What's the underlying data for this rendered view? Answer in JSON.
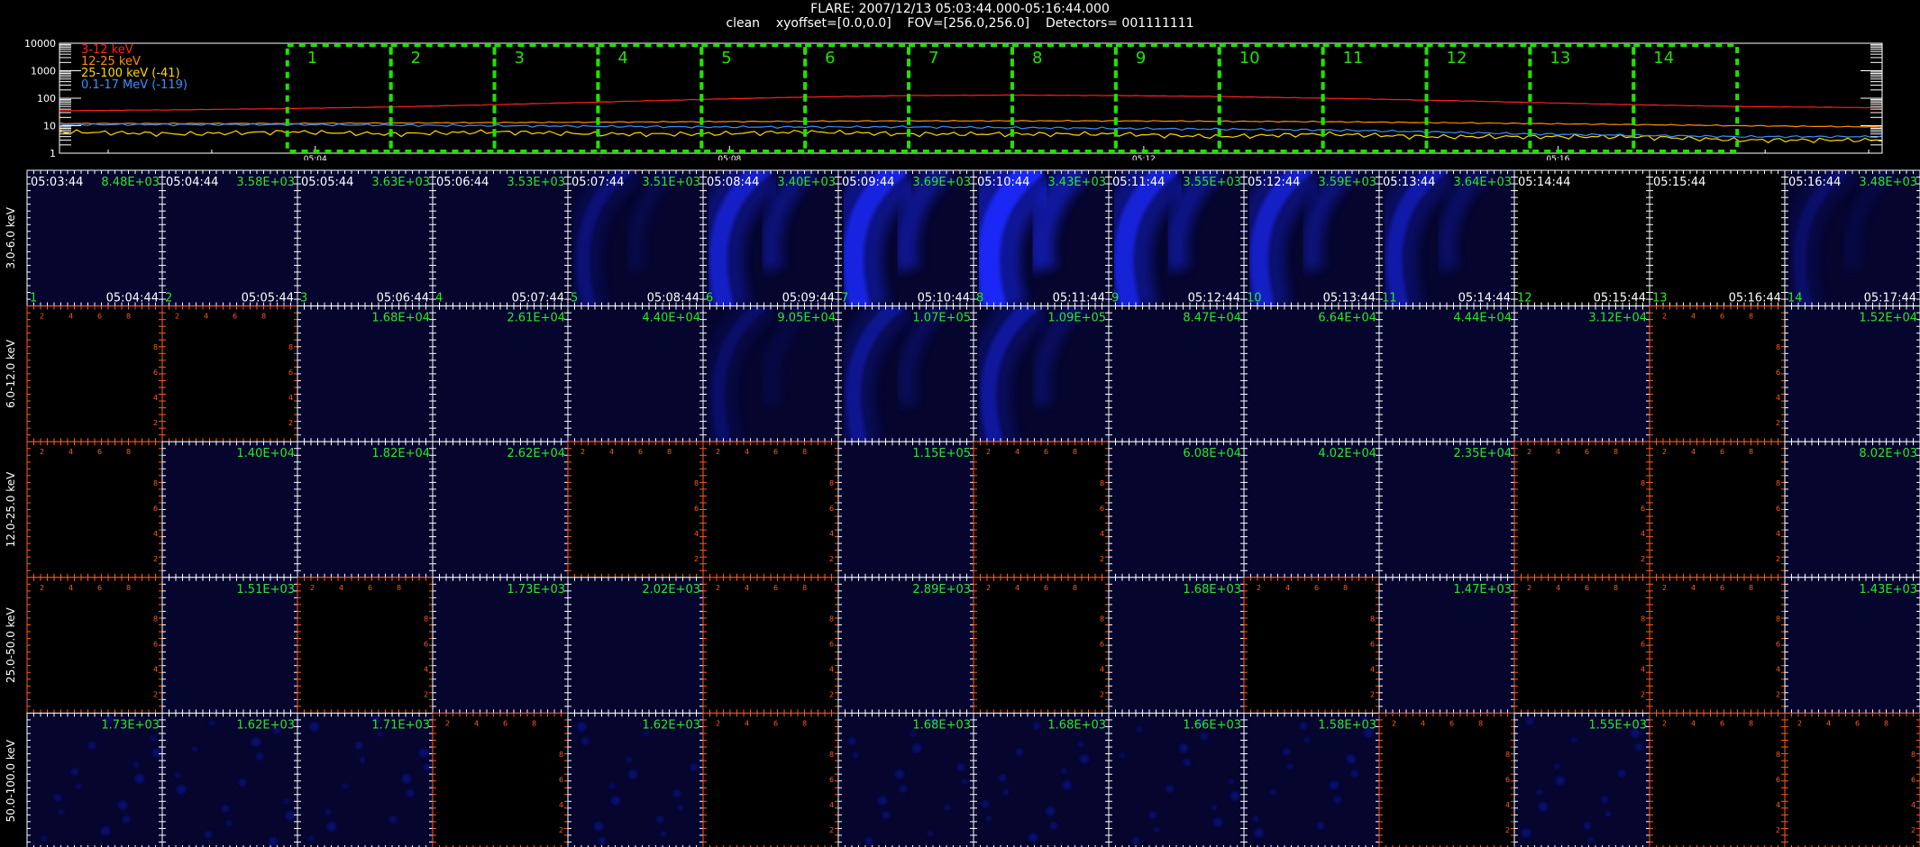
{
  "title_line1": "FLARE: 2007/12/13 05:03:44.000-05:16:44.000",
  "title_line2": "clean    xyoffset=[0.0,0.0]    FOV=[256.0,256.0]    Detectors= 001111111",
  "chart_data": [
    {
      "type": "line",
      "title": "",
      "y_scale": "log",
      "ylim": [
        1,
        10000
      ],
      "y_tick_labels": [
        "10000",
        "1000",
        "100",
        "10",
        "1"
      ],
      "x_tick_labels": [
        "05:04",
        "05:08",
        "05:12",
        "05:16"
      ],
      "x_tick_minutes": [
        0.27,
        4.27,
        8.27,
        12.27
      ],
      "x_range_minutes": [
        -2.2,
        15.4
      ],
      "legend": [
        "3-12 keV",
        "12-25 keV",
        "25-100 keV (-41)",
        "0.1-17 MeV (-119)"
      ],
      "series_colors": [
        "#ff2020",
        "#ff8c00",
        "#ffd700",
        "#3a8fff"
      ],
      "series": [
        {
          "name": "3-12 keV",
          "x": [
            -2.2,
            -1,
            0,
            1,
            2,
            3,
            4,
            5,
            6,
            7,
            8,
            9,
            10,
            11,
            12,
            13,
            14,
            15.4
          ],
          "values": [
            35,
            38,
            42,
            48,
            58,
            72,
            90,
            110,
            125,
            130,
            125,
            115,
            100,
            85,
            70,
            58,
            50,
            45
          ]
        },
        {
          "name": "12-25 keV",
          "x": [
            -2.2,
            0,
            2,
            4,
            6,
            8,
            10,
            12,
            14,
            15.4
          ],
          "values": [
            12,
            12,
            13,
            14,
            15,
            15,
            14,
            12,
            10,
            9
          ]
        },
        {
          "name": "25-100 keV (-41)",
          "x": [
            -2.2,
            -1,
            0,
            1,
            2,
            3,
            4,
            5,
            6,
            7,
            8,
            9,
            10,
            11,
            12,
            13,
            14,
            15.4
          ],
          "values": [
            6,
            5,
            6,
            5,
            6,
            5,
            5,
            6,
            5,
            5,
            5,
            4,
            5,
            4,
            4,
            4,
            3,
            3
          ]
        },
        {
          "name": "0.1-17 MeV (-119)",
          "x": [
            -2.2,
            0,
            2,
            4,
            6,
            8,
            10,
            12,
            14,
            15.4
          ],
          "values": [
            11,
            11,
            10,
            9,
            9,
            8,
            7,
            5,
            4,
            4
          ]
        }
      ],
      "intervals": [
        {
          "label": "1",
          "start": 0,
          "end": 1
        },
        {
          "label": "2",
          "start": 1,
          "end": 2
        },
        {
          "label": "3",
          "start": 2,
          "end": 3
        },
        {
          "label": "4",
          "start": 3,
          "end": 4
        },
        {
          "label": "5",
          "start": 4,
          "end": 5
        },
        {
          "label": "6",
          "start": 5,
          "end": 6
        },
        {
          "label": "7",
          "start": 6,
          "end": 7
        },
        {
          "label": "8",
          "start": 7,
          "end": 8
        },
        {
          "label": "9",
          "start": 8,
          "end": 9
        },
        {
          "label": "10",
          "start": 9,
          "end": 10
        },
        {
          "label": "11",
          "start": 10,
          "end": 11
        },
        {
          "label": "12",
          "start": 11,
          "end": 12
        },
        {
          "label": "13",
          "start": 12,
          "end": 13
        },
        {
          "label": "14",
          "start": 13,
          "end": 14
        }
      ],
      "interval_color": "#22e000"
    },
    {
      "type": "heatmap",
      "energy_bands": [
        "3.0-6.0 keV",
        "6.0-12.0 keV",
        "12.0-25.0 keV",
        "25.0-50.0 keV",
        "50.0-100.0 keV"
      ],
      "start_times": [
        "05:03:44",
        "05:04:44",
        "05:05:44",
        "05:06:44",
        "05:07:44",
        "05:08:44",
        "05:09:44",
        "05:10:44",
        "05:11:44",
        "05:12:44",
        "05:13:44",
        "05:14:44",
        "05:15:44",
        "05:16:44"
      ],
      "end_times": [
        "05:04:44",
        "05:05:44",
        "05:06:44",
        "05:07:44",
        "05:08:44",
        "05:09:44",
        "05:10:44",
        "05:11:44",
        "05:12:44",
        "05:13:44",
        "05:14:44",
        "05:15:44",
        "05:16:44",
        "05:17:44"
      ],
      "image_numbers": [
        "1",
        "2",
        "3",
        "4",
        "5",
        "6",
        "7",
        "8",
        "9",
        "10",
        "11",
        "12",
        "13",
        "14"
      ],
      "max_values": [
        [
          "8.48E+03",
          "3.58E+03",
          "3.63E+03",
          "3.53E+03",
          "3.51E+03",
          "3.40E+03",
          "3.69E+03",
          "3.43E+03",
          "3.55E+03",
          "3.59E+03",
          "3.64E+03",
          "",
          "",
          "3.48E+03"
        ],
        [
          "",
          "",
          "1.68E+04",
          "2.61E+04",
          "4.40E+04",
          "9.05E+04",
          "1.07E+05",
          "1.09E+05",
          "8.47E+04",
          "6.64E+04",
          "4.44E+04",
          "3.12E+04",
          "",
          "1.52E+04"
        ],
        [
          "",
          "1.40E+04",
          "1.82E+04",
          "2.62E+04",
          "",
          "",
          "1.15E+05",
          "",
          "6.08E+04",
          "4.02E+04",
          "2.35E+04",
          "",
          "",
          "8.02E+03"
        ],
        [
          "",
          "1.51E+03",
          "",
          "1.73E+03",
          "2.02E+03",
          "",
          "2.89E+03",
          "",
          "1.68E+03",
          "",
          "1.47E+03",
          "",
          "",
          "1.43E+03"
        ],
        [
          "1.73E+03",
          "1.62E+03",
          "1.71E+03",
          "",
          "1.62E+03",
          "",
          "1.68E+03",
          "1.68E+03",
          "1.66E+03",
          "1.58E+03",
          "",
          "1.55E+03",
          "",
          ""
        ]
      ],
      "intensity": [
        [
          0.05,
          0.05,
          0.05,
          0.05,
          0.25,
          0.6,
          0.75,
          0.9,
          0.7,
          0.6,
          0.45,
          0,
          0,
          0.2
        ],
        [
          0,
          0,
          0.05,
          0.05,
          0.05,
          0.2,
          0.35,
          0.4,
          0.05,
          0.05,
          0.05,
          0.05,
          0,
          0.05
        ],
        [
          0,
          0.05,
          0.05,
          0.05,
          0,
          0,
          0.05,
          0,
          0.05,
          0.05,
          0.05,
          0,
          0,
          0.05
        ],
        [
          0,
          0.05,
          0,
          0.05,
          0.05,
          0,
          0.05,
          0,
          0.05,
          0,
          0.05,
          0,
          0,
          0.05
        ],
        [
          0.1,
          0.1,
          0.1,
          0,
          0.1,
          0,
          0.1,
          0.1,
          0.1,
          0.1,
          0,
          0.1,
          0,
          0
        ]
      ],
      "axis_tick_labels": [
        "2",
        "4",
        "6",
        "8"
      ],
      "colors": {
        "cell_bg": "#05052e",
        "empty_bg": "#000000",
        "blue": "#1a2cff",
        "value_text": "#2ce62c",
        "empty_axis": "#ff5a1a",
        "grid_line": "#ffffff"
      }
    }
  ]
}
